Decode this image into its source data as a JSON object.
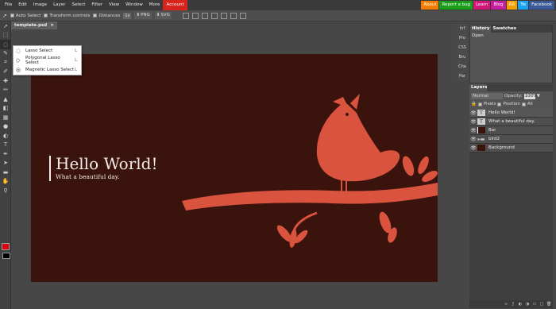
{
  "menubar": {
    "items": [
      "File",
      "Edit",
      "Image",
      "Layer",
      "Select",
      "Filter",
      "View",
      "Window",
      "More",
      "Account"
    ],
    "links": [
      {
        "label": "About",
        "color": "#f47c00"
      },
      {
        "label": "Report a bug",
        "color": "#1a9e1a"
      },
      {
        "label": "Learn",
        "color": "#d1187a"
      },
      {
        "label": "Blog",
        "color": "#c61f9e"
      },
      {
        "label": "AR",
        "color": "#f4a000"
      },
      {
        "label": "Tw",
        "color": "#1da1f2"
      },
      {
        "label": "Facebook",
        "color": "#3b5998"
      }
    ]
  },
  "toolbar": {
    "auto_select": "Auto Select",
    "transform_controls": "Transform controls",
    "distances": "Distances",
    "scale": "1x",
    "png": "PNG",
    "svg": "SVG"
  },
  "document": {
    "tab_label": "template.psd",
    "close_glyph": "×",
    "title": "Hello World!",
    "subtitle": "What a beautiful day."
  },
  "lasso_menu": {
    "items": [
      {
        "label": "Lasso Select",
        "key": "L"
      },
      {
        "label": "Polygonal Lasso Select",
        "key": "L"
      },
      {
        "label": "Magnetic Lasso Select",
        "key": "L"
      }
    ]
  },
  "mini_panel": {
    "items": [
      "Inf",
      "Pro",
      "CSS",
      "Bru",
      "Cha",
      "Par"
    ]
  },
  "history": {
    "tabs": [
      "History",
      "Swatches"
    ],
    "items": [
      "Open"
    ]
  },
  "layers": {
    "title": "Layers",
    "blend_mode": "Normal",
    "opacity_label": "Opacity:",
    "opacity_value": "100%",
    "lock_options": [
      "Pixels",
      "Position",
      "All"
    ],
    "rows": [
      {
        "name": "Hello World!",
        "thumb": "T"
      },
      {
        "name": "What a beautiful day.",
        "thumb": "T"
      },
      {
        "name": "Bar",
        "thumb": ""
      },
      {
        "name": "bird2",
        "thumb": "▸"
      },
      {
        "name": "Background",
        "thumb": ""
      }
    ],
    "footer_icons": [
      "eff",
      "fx",
      "mask",
      "adj",
      "folder",
      "new",
      "trash"
    ]
  },
  "colors": {
    "art_bg": "#3a130d",
    "bird": "#d9533f",
    "foreground": "#e2000a",
    "background": "#000000"
  }
}
